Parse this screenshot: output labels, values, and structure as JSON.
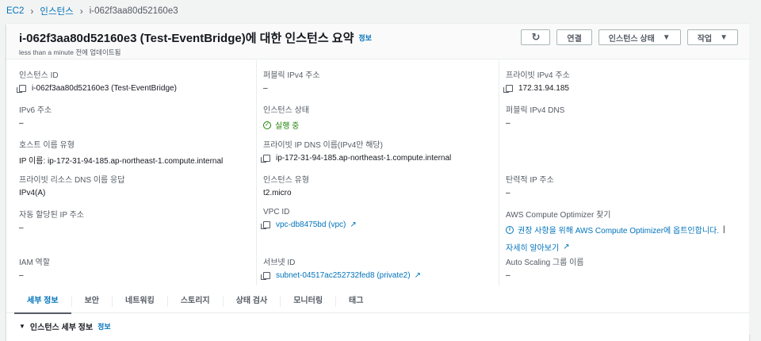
{
  "breadcrumb": [
    "EC2",
    "인스턴스",
    "i-062f3aa80d52160e3"
  ],
  "header": {
    "title": "i-062f3aa80d52160e3 (Test-EventBridge)에 대한 인스턴스 요약",
    "info": "정보",
    "updated": "less than a minute 전에 업데이트됨",
    "buttons": {
      "refresh": "↻",
      "connect": "연결",
      "state": "인스턴스 상태",
      "actions": "작업"
    }
  },
  "fields": {
    "instance_id": {
      "label": "인스턴스 ID",
      "value": "i-062f3aa80d52160e3 (Test-EventBridge)"
    },
    "ipv6": {
      "label": "IPv6 주소",
      "value": "–"
    },
    "hostname_type": {
      "label": "호스트 이름 유형",
      "value": "IP 이름: ip-172-31-94-185.ap-northeast-1.compute.internal"
    },
    "private_dns_resp": {
      "label": "프라이빗 리소스 DNS 이름 응답",
      "value": "IPv4(A)"
    },
    "auto_ip": {
      "label": "자동 할당된 IP 주소",
      "value": "–"
    },
    "iam": {
      "label": "IAM 역할",
      "value": "–"
    },
    "public_ipv4": {
      "label": "퍼블릭 IPv4 주소",
      "value": "–"
    },
    "state": {
      "label": "인스턴스 상태",
      "value": "실행 중"
    },
    "private_dns": {
      "label": "프라이빗 IP DNS 이름(IPv4만 해당)",
      "value": "ip-172-31-94-185.ap-northeast-1.compute.internal"
    },
    "type": {
      "label": "인스턴스 유형",
      "value": "t2.micro"
    },
    "vpc": {
      "label": "VPC ID",
      "value": "vpc-db8475bd (vpc)"
    },
    "subnet": {
      "label": "서브넷 ID",
      "value": "subnet-04517ac252732fed8 (private2)"
    },
    "private_ipv4": {
      "label": "프라이빗 IPv4 주소",
      "value": "172.31.94.185"
    },
    "public_dns": {
      "label": "퍼블릭 IPv4 DNS",
      "value": "–"
    },
    "elastic_ip": {
      "label": "탄력적 IP 주소",
      "value": "–"
    },
    "optimizer": {
      "label": "AWS Compute Optimizer 찾기",
      "value": "권장 사항을 위해 AWS Compute Optimizer에 옵트인합니다.",
      "learn": "자세히 알아보기"
    },
    "asg": {
      "label": "Auto Scaling 그룹 이름",
      "value": "–"
    }
  },
  "tabs": [
    "세부 정보",
    "보안",
    "네트워킹",
    "스토리지",
    "상태 검사",
    "모니터링",
    "태그"
  ],
  "section": {
    "title": "인스턴스 세부 정보",
    "info": "정보"
  }
}
